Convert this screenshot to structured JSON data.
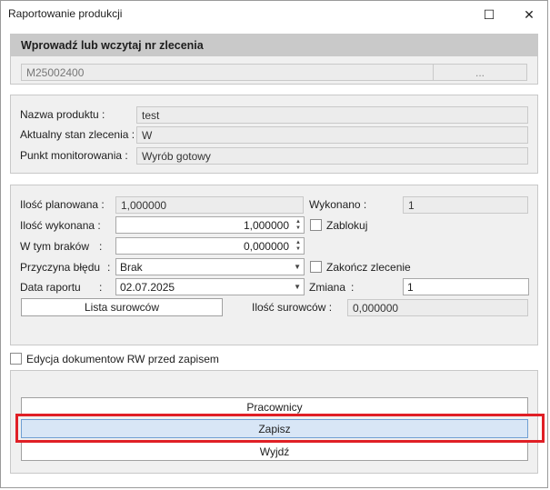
{
  "window": {
    "title": "Raportowanie produkcji",
    "maximize_glyph": "☐",
    "close_glyph": "✕"
  },
  "order": {
    "header": "Wprowadź lub wczytaj nr zlecenia",
    "number": "M25002400",
    "browse_label": "..."
  },
  "info": {
    "product_name_label": "Nazwa produktu :",
    "product_name": "test",
    "status_label": "Aktualny stan zlecenia :",
    "status": "W",
    "monitor_point_label": "Punkt monitorowania :",
    "monitor_point": "Wyrób gotowy"
  },
  "form": {
    "planned_label": "Ilość planowana :",
    "planned": "1,000000",
    "done_label": "Wykonano :",
    "done": "1",
    "executed_label": "Ilość wykonana :",
    "executed": "1,000000",
    "lock_label": "Zablokuj",
    "defects_label": "W tym braków",
    "defects_colon": ":",
    "defects": "0,000000",
    "error_reason_label": "Przyczyna błędu",
    "error_reason_colon": ":",
    "error_reason": "Brak",
    "close_order_label": "Zakończ zlecenie",
    "report_date_label": "Data raportu",
    "report_date_colon": ":",
    "report_date": "02.07.2025",
    "shift_label": "Zmiana",
    "shift_colon": ":",
    "shift": "1",
    "materials_button": "Lista surowców",
    "materials_qty_label": "Ilość surowców :",
    "materials_qty": "0,000000"
  },
  "rw_edit_label": "Edycja dokumentow RW przed zapisem",
  "actions": {
    "workers": "Pracownicy",
    "save": "Zapisz",
    "exit": "Wyjdź"
  },
  "colors": {
    "highlight": "#e01f26",
    "primary_button": "#d8e6f6",
    "header_bar": "#c9c9c9",
    "panel": "#f0f0f0"
  }
}
